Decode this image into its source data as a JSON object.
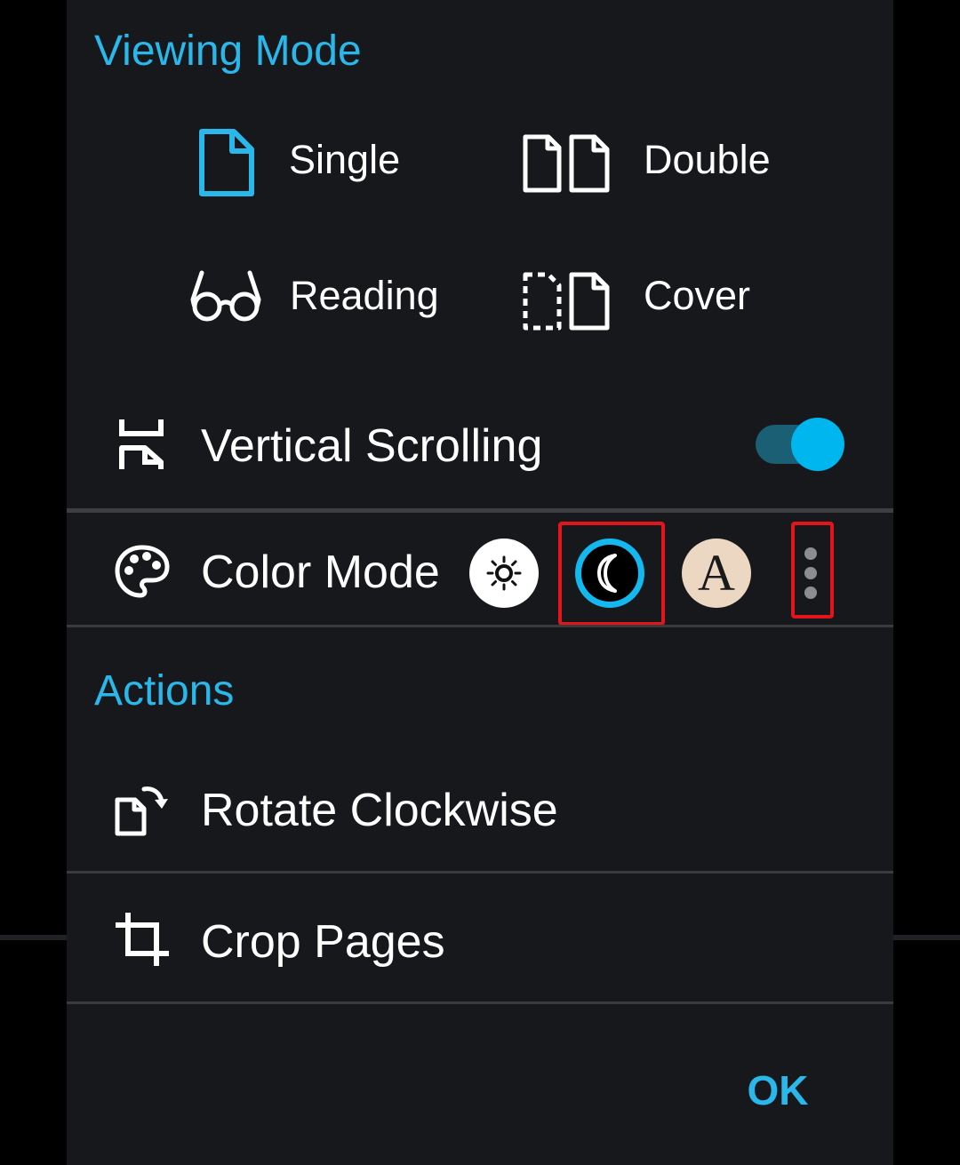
{
  "viewing_mode": {
    "title": "Viewing Mode",
    "options": [
      {
        "label": "Single",
        "icon": "single-page-icon",
        "selected": true
      },
      {
        "label": "Double",
        "icon": "double-page-icon",
        "selected": false
      },
      {
        "label": "Reading",
        "icon": "glasses-icon",
        "selected": false
      },
      {
        "label": "Cover",
        "icon": "cover-page-icon",
        "selected": false
      }
    ]
  },
  "vertical_scrolling": {
    "label": "Vertical Scrolling",
    "icon": "vertical-scroll-icon",
    "enabled": true
  },
  "color_mode": {
    "label": "Color Mode",
    "icon": "palette-icon",
    "sepia_letter": "A",
    "selected": "dark"
  },
  "actions": {
    "title": "Actions",
    "rotate_label": "Rotate Clockwise",
    "crop_label": "Crop Pages"
  },
  "ok_label": "OK",
  "colors": {
    "accent": "#2ab7ea",
    "background": "#17181c",
    "toggle_knob": "#00b6ef",
    "toggle_track": "#1b5f74",
    "highlight": "#e3151a",
    "sepia": "#ecd8c2"
  }
}
